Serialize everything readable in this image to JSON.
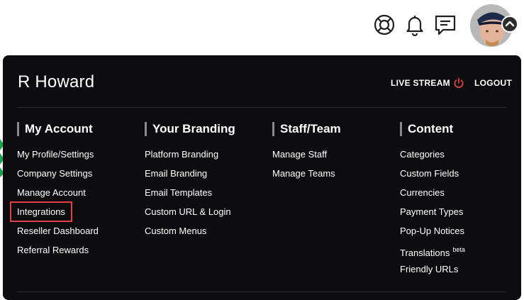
{
  "topbar": {
    "icons": [
      "support-icon",
      "bell-icon",
      "chat-icon"
    ]
  },
  "menu": {
    "user_name": "R Howard",
    "live_stream": "LIVE STREAM",
    "logout": "LOGOUT",
    "accent_color": "#e04040",
    "columns": [
      {
        "title": "My Account",
        "items": [
          "My Profile/Settings",
          "Company Settings",
          "Manage Account",
          "Integrations",
          "Reseller Dashboard",
          "Referral Rewards"
        ]
      },
      {
        "title": "Your Branding",
        "items": [
          "Platform Branding",
          "Email Branding",
          "Email Templates",
          "Custom URL & Login",
          "Custom Menus"
        ]
      },
      {
        "title": "Staff/Team",
        "items": [
          "Manage Staff",
          "Manage Teams"
        ]
      },
      {
        "title": "Content",
        "items": [
          "Categories",
          "Custom Fields",
          "Currencies",
          "Payment Types",
          "Pop-Up Notices",
          "Translations",
          "Friendly URLs"
        ],
        "translations_badge": "beta"
      }
    ]
  }
}
